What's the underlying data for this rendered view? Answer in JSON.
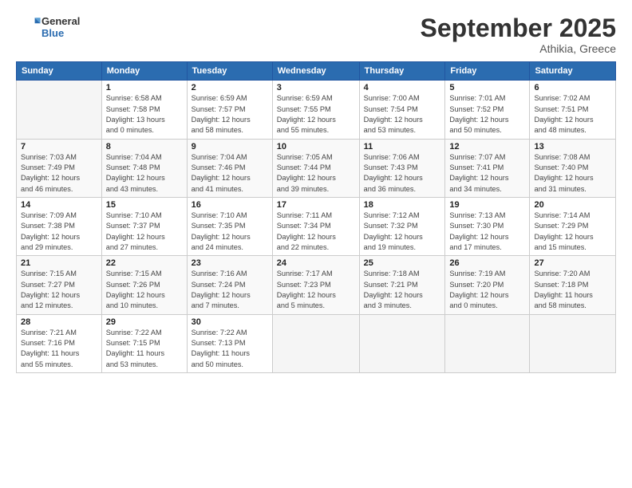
{
  "header": {
    "logo_general": "General",
    "logo_blue": "Blue",
    "month": "September 2025",
    "location": "Athikia, Greece"
  },
  "weekdays": [
    "Sunday",
    "Monday",
    "Tuesday",
    "Wednesday",
    "Thursday",
    "Friday",
    "Saturday"
  ],
  "weeks": [
    [
      {
        "day": "",
        "info": ""
      },
      {
        "day": "1",
        "info": "Sunrise: 6:58 AM\nSunset: 7:58 PM\nDaylight: 13 hours\nand 0 minutes."
      },
      {
        "day": "2",
        "info": "Sunrise: 6:59 AM\nSunset: 7:57 PM\nDaylight: 12 hours\nand 58 minutes."
      },
      {
        "day": "3",
        "info": "Sunrise: 6:59 AM\nSunset: 7:55 PM\nDaylight: 12 hours\nand 55 minutes."
      },
      {
        "day": "4",
        "info": "Sunrise: 7:00 AM\nSunset: 7:54 PM\nDaylight: 12 hours\nand 53 minutes."
      },
      {
        "day": "5",
        "info": "Sunrise: 7:01 AM\nSunset: 7:52 PM\nDaylight: 12 hours\nand 50 minutes."
      },
      {
        "day": "6",
        "info": "Sunrise: 7:02 AM\nSunset: 7:51 PM\nDaylight: 12 hours\nand 48 minutes."
      }
    ],
    [
      {
        "day": "7",
        "info": "Sunrise: 7:03 AM\nSunset: 7:49 PM\nDaylight: 12 hours\nand 46 minutes."
      },
      {
        "day": "8",
        "info": "Sunrise: 7:04 AM\nSunset: 7:48 PM\nDaylight: 12 hours\nand 43 minutes."
      },
      {
        "day": "9",
        "info": "Sunrise: 7:04 AM\nSunset: 7:46 PM\nDaylight: 12 hours\nand 41 minutes."
      },
      {
        "day": "10",
        "info": "Sunrise: 7:05 AM\nSunset: 7:44 PM\nDaylight: 12 hours\nand 39 minutes."
      },
      {
        "day": "11",
        "info": "Sunrise: 7:06 AM\nSunset: 7:43 PM\nDaylight: 12 hours\nand 36 minutes."
      },
      {
        "day": "12",
        "info": "Sunrise: 7:07 AM\nSunset: 7:41 PM\nDaylight: 12 hours\nand 34 minutes."
      },
      {
        "day": "13",
        "info": "Sunrise: 7:08 AM\nSunset: 7:40 PM\nDaylight: 12 hours\nand 31 minutes."
      }
    ],
    [
      {
        "day": "14",
        "info": "Sunrise: 7:09 AM\nSunset: 7:38 PM\nDaylight: 12 hours\nand 29 minutes."
      },
      {
        "day": "15",
        "info": "Sunrise: 7:10 AM\nSunset: 7:37 PM\nDaylight: 12 hours\nand 27 minutes."
      },
      {
        "day": "16",
        "info": "Sunrise: 7:10 AM\nSunset: 7:35 PM\nDaylight: 12 hours\nand 24 minutes."
      },
      {
        "day": "17",
        "info": "Sunrise: 7:11 AM\nSunset: 7:34 PM\nDaylight: 12 hours\nand 22 minutes."
      },
      {
        "day": "18",
        "info": "Sunrise: 7:12 AM\nSunset: 7:32 PM\nDaylight: 12 hours\nand 19 minutes."
      },
      {
        "day": "19",
        "info": "Sunrise: 7:13 AM\nSunset: 7:30 PM\nDaylight: 12 hours\nand 17 minutes."
      },
      {
        "day": "20",
        "info": "Sunrise: 7:14 AM\nSunset: 7:29 PM\nDaylight: 12 hours\nand 15 minutes."
      }
    ],
    [
      {
        "day": "21",
        "info": "Sunrise: 7:15 AM\nSunset: 7:27 PM\nDaylight: 12 hours\nand 12 minutes."
      },
      {
        "day": "22",
        "info": "Sunrise: 7:15 AM\nSunset: 7:26 PM\nDaylight: 12 hours\nand 10 minutes."
      },
      {
        "day": "23",
        "info": "Sunrise: 7:16 AM\nSunset: 7:24 PM\nDaylight: 12 hours\nand 7 minutes."
      },
      {
        "day": "24",
        "info": "Sunrise: 7:17 AM\nSunset: 7:23 PM\nDaylight: 12 hours\nand 5 minutes."
      },
      {
        "day": "25",
        "info": "Sunrise: 7:18 AM\nSunset: 7:21 PM\nDaylight: 12 hours\nand 3 minutes."
      },
      {
        "day": "26",
        "info": "Sunrise: 7:19 AM\nSunset: 7:20 PM\nDaylight: 12 hours\nand 0 minutes."
      },
      {
        "day": "27",
        "info": "Sunrise: 7:20 AM\nSunset: 7:18 PM\nDaylight: 11 hours\nand 58 minutes."
      }
    ],
    [
      {
        "day": "28",
        "info": "Sunrise: 7:21 AM\nSunset: 7:16 PM\nDaylight: 11 hours\nand 55 minutes."
      },
      {
        "day": "29",
        "info": "Sunrise: 7:22 AM\nSunset: 7:15 PM\nDaylight: 11 hours\nand 53 minutes."
      },
      {
        "day": "30",
        "info": "Sunrise: 7:22 AM\nSunset: 7:13 PM\nDaylight: 11 hours\nand 50 minutes."
      },
      {
        "day": "",
        "info": ""
      },
      {
        "day": "",
        "info": ""
      },
      {
        "day": "",
        "info": ""
      },
      {
        "day": "",
        "info": ""
      }
    ]
  ]
}
